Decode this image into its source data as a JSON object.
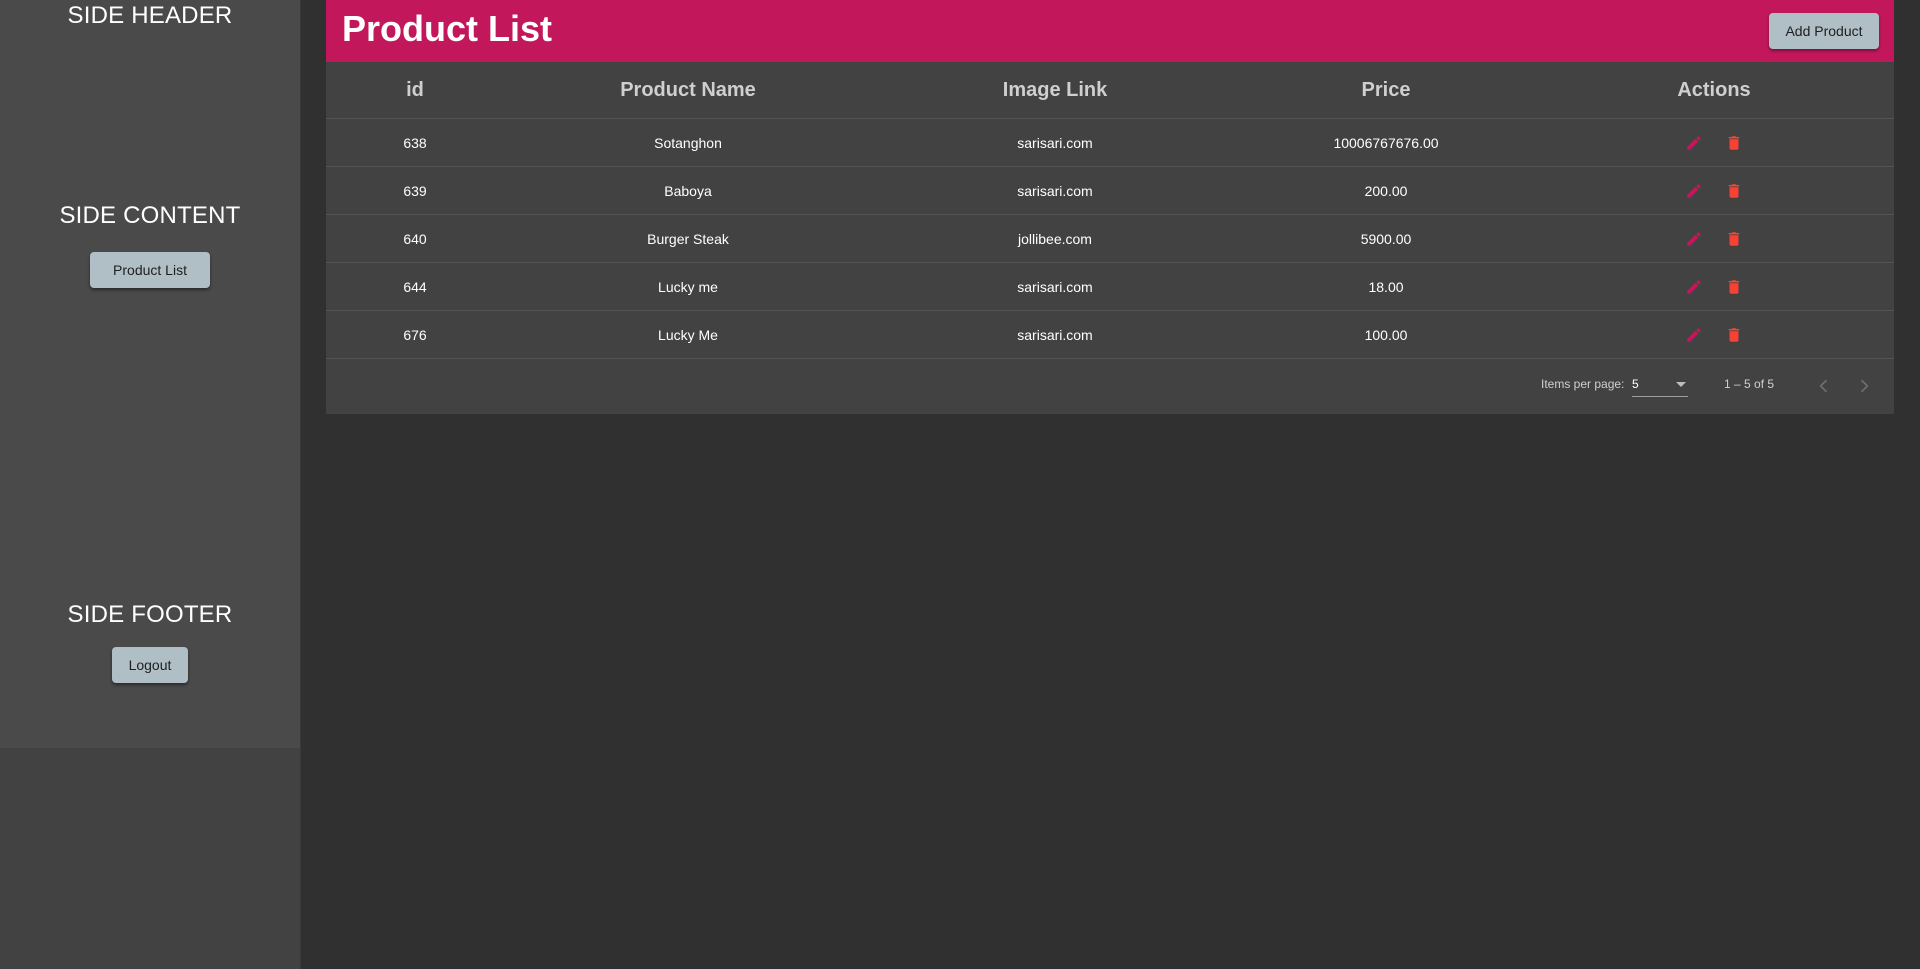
{
  "sidebar": {
    "header": "SIDE HEADER",
    "content_title": "SIDE CONTENT",
    "product_list_button": "Product List",
    "footer_title": "SIDE FOOTER",
    "logout_button": "Logout"
  },
  "toolbar": {
    "title": "Product List",
    "add_button": "Add Product",
    "color": "#c2185b"
  },
  "table": {
    "headers": {
      "id": "id",
      "name": "Product Name",
      "link": "Image Link",
      "price": "Price",
      "actions": "Actions"
    },
    "rows": [
      {
        "id": "638",
        "name": "Sotanghon",
        "link": "sarisari.com",
        "price": "10006767676.00"
      },
      {
        "id": "639",
        "name": "Baboya",
        "link": "sarisari.com",
        "price": "200.00"
      },
      {
        "id": "640",
        "name": "Burger Steak",
        "link": "jollibee.com",
        "price": "5900.00"
      },
      {
        "id": "644",
        "name": "Lucky me",
        "link": "sarisari.com",
        "price": "18.00"
      },
      {
        "id": "676",
        "name": "Lucky Me",
        "link": "sarisari.com",
        "price": "100.00"
      }
    ],
    "icons": {
      "edit": "pencil-icon",
      "delete": "trash-icon",
      "edit_color": "#c2185b",
      "delete_color": "#f44336"
    }
  },
  "paginator": {
    "items_per_page_label": "Items per page:",
    "page_size": "5",
    "range": "1 – 5 of 5",
    "prev_icon": "chevron-left-icon",
    "next_icon": "chevron-right-icon"
  }
}
